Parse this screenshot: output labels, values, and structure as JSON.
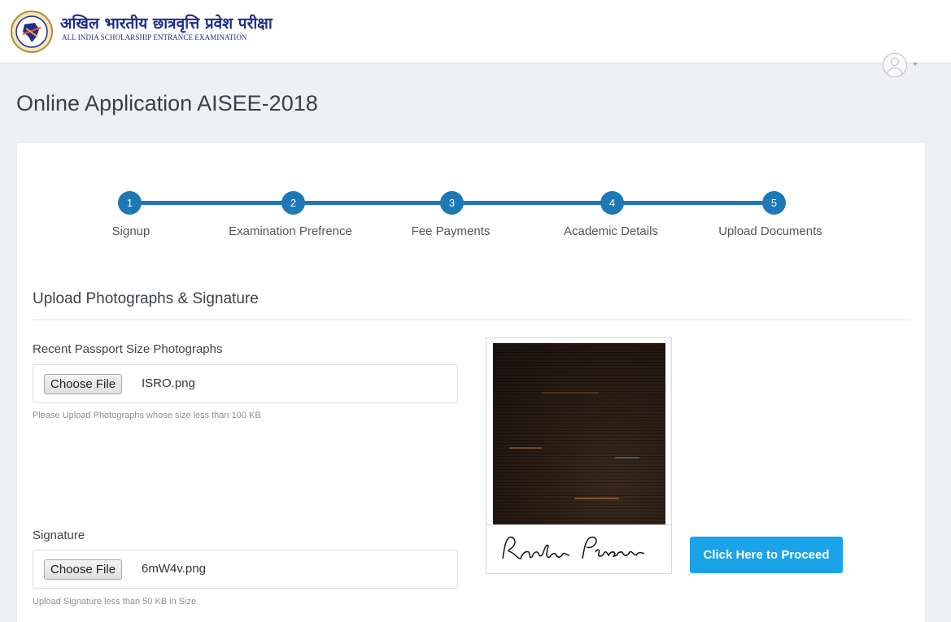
{
  "header": {
    "logo_hindi": "अखिल भारतीय छात्रवृत्ति प्रवेश परीक्षा",
    "logo_english": "ALL INDIA SCHOLARSHIP ENTRANCE EXAMINATION"
  },
  "page": {
    "title": "Online Application AISEE-2018"
  },
  "stepper": {
    "steps": [
      {
        "number": "1",
        "label": "Signup"
      },
      {
        "number": "2",
        "label": "Examination Prefrence"
      },
      {
        "number": "3",
        "label": "Fee Payments"
      },
      {
        "number": "4",
        "label": "Academic Details"
      },
      {
        "number": "5",
        "label": "Upload Documents"
      }
    ],
    "active_color": "#1d79b6"
  },
  "upload": {
    "section_title": "Upload Photographs & Signature",
    "photo": {
      "label": "Recent Passport Size Photographs",
      "button_label": "Choose File",
      "file_name": "ISRO.png",
      "help": "Please Upload Photographs whose size less than 100 KB"
    },
    "signature": {
      "label": "Signature",
      "button_label": "Choose File",
      "file_name": "6mW4v.png",
      "help": "Upload Signature less than 50 KB in Size"
    },
    "proceed_label": "Click Here to Proceed",
    "signature_text": "Random Person"
  },
  "colors": {
    "accent": "#1d79b6",
    "proceed_button": "#1aa3e8",
    "logo_text": "#1f2c8c"
  }
}
